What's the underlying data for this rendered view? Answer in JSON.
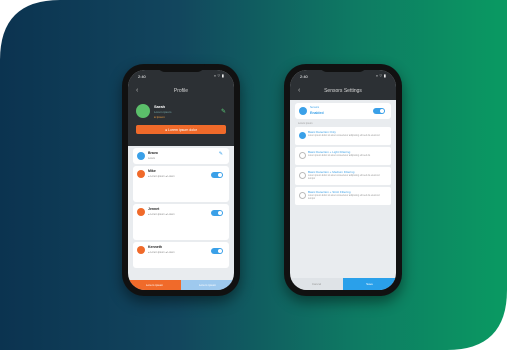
{
  "left_phone": {
    "status_time": "2:40",
    "status_icons": "▪ ⌔ ▮",
    "title": "Profile",
    "back_icon": "chevron-left-icon",
    "user": {
      "name": "Sarah",
      "sub": "Lorem ipsum",
      "badge": "● Ipsum"
    },
    "primary_button": "● Lorem ipsum dolor",
    "cards": [
      {
        "title": "Bravo",
        "sub": "Lorem",
        "color": "#3aa0e8",
        "toggle": false
      },
      {
        "title": "Mike",
        "sub": "● Lorem ipsum  ● Lorem",
        "color": "#f06a2a",
        "toggle": true
      },
      {
        "title": "Jennet",
        "sub": "● Lorem ipsum  ● Lorem",
        "color": "#f06a2a",
        "toggle": true
      },
      {
        "title": "Kenneth",
        "sub": "● Lorem ipsum  ● Lorem",
        "color": "#f06a2a",
        "toggle": true
      }
    ],
    "footer_left": "Lorem ipsum",
    "footer_right": "Lorem ipsum"
  },
  "right_phone": {
    "status_time": "2:40",
    "status_icons": "▪ ⌔ ▮",
    "title": "Sensors Settings",
    "back_icon": "chevron-left-icon",
    "header": {
      "label": "Sensors",
      "value": "Enabled"
    },
    "section_label": "Lorem ipsum",
    "options": [
      {
        "title": "Basic Detection Only",
        "desc": "Lorem ipsum dolor sit amet consectetur adipiscing elit sed do eiusmod",
        "selected": true
      },
      {
        "title": "Basic Detection + Light Filtering",
        "desc": "Lorem ipsum dolor sit amet consectetur adipiscing elit sed do",
        "selected": false
      },
      {
        "title": "Basic Detection + Medium Filtering",
        "desc": "Lorem ipsum dolor sit amet consectetur adipiscing elit sed do eiusmod tempor",
        "selected": false
      },
      {
        "title": "Basic Detection + Strict Filtering",
        "desc": "Lorem ipsum dolor sit amet consectetur adipiscing elit sed do eiusmod tempor",
        "selected": false
      }
    ],
    "footer_left": "Cancel",
    "footer_right": "Save"
  }
}
